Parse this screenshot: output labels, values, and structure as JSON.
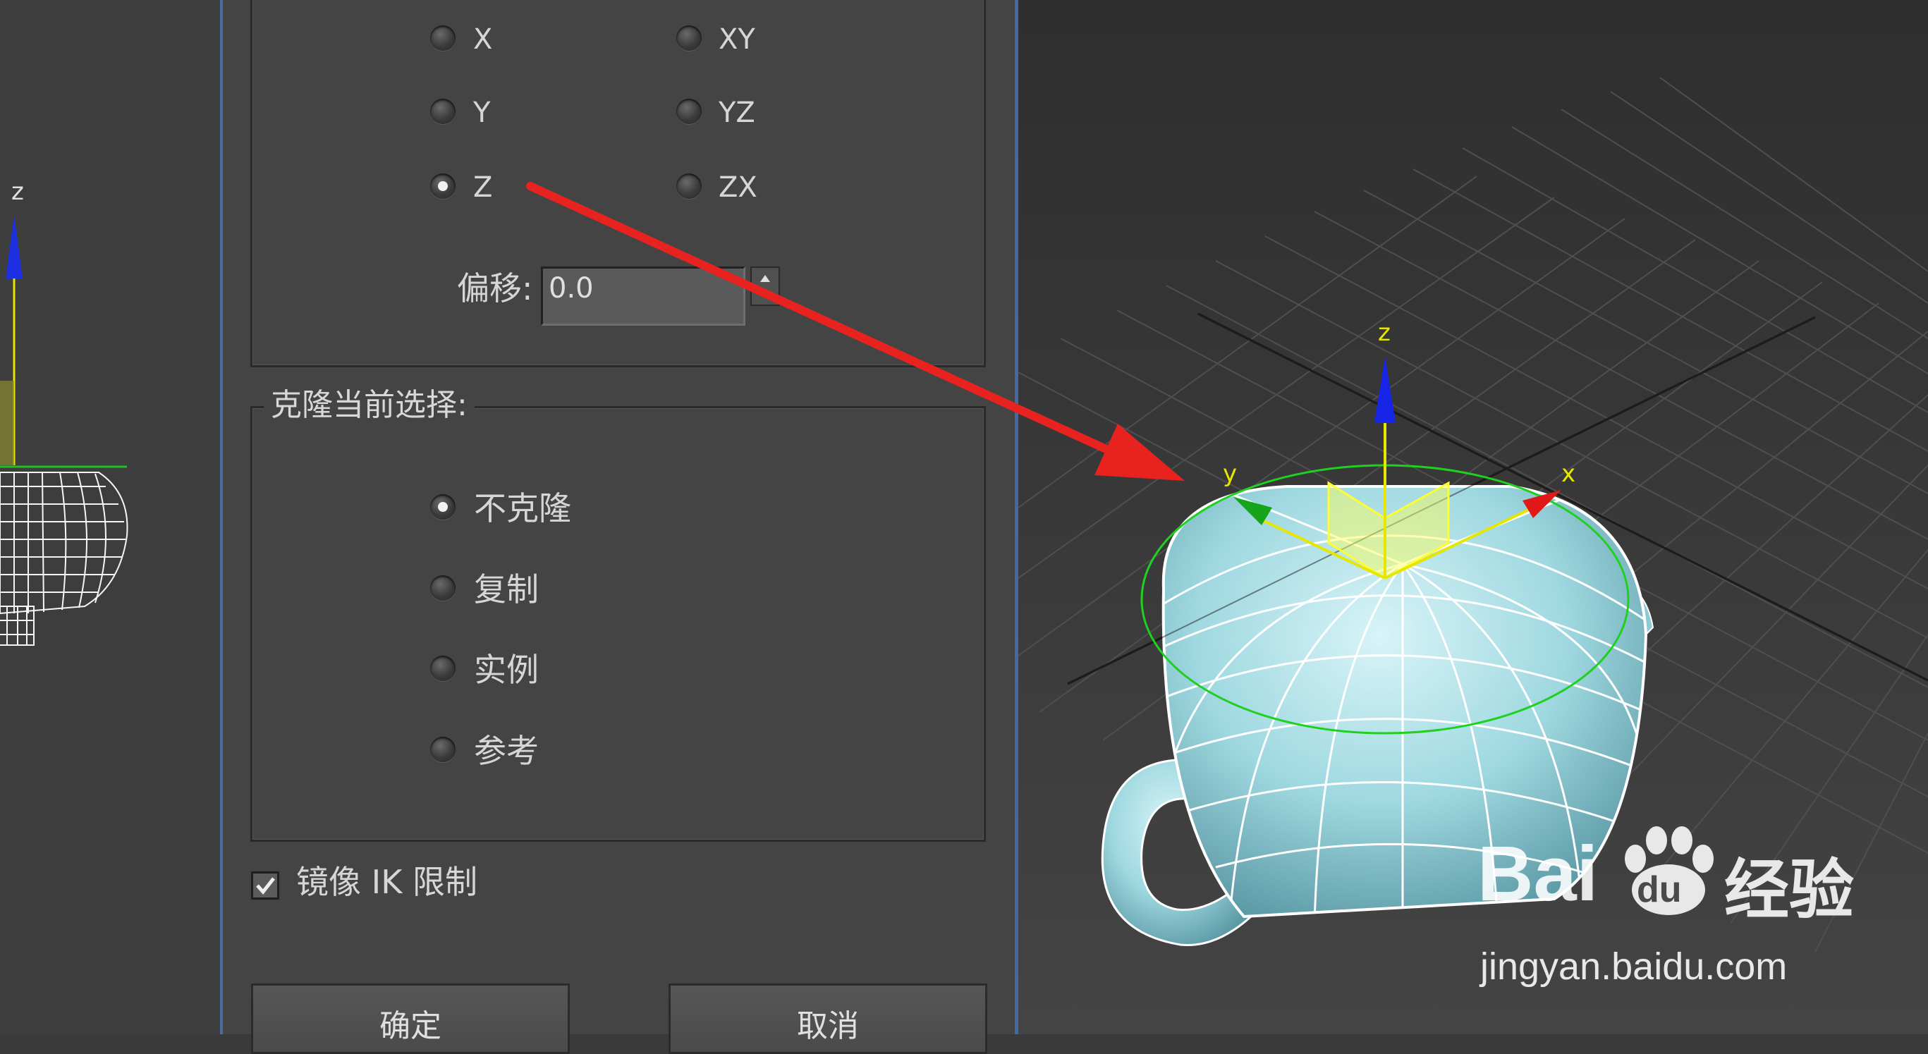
{
  "left_viewport": {
    "axis_z": "z"
  },
  "mirror_axis": {
    "options": [
      {
        "label": "X",
        "selected": false
      },
      {
        "label": "Y",
        "selected": false
      },
      {
        "label": "Z",
        "selected": true
      },
      {
        "label": "XY",
        "selected": false
      },
      {
        "label": "YZ",
        "selected": false
      },
      {
        "label": "ZX",
        "selected": false
      }
    ],
    "offset_label": "偏移:",
    "offset_value": "0.0"
  },
  "clone": {
    "title": "克隆当前选择:",
    "options": [
      {
        "label": "不克隆",
        "selected": true
      },
      {
        "label": "复制",
        "selected": false
      },
      {
        "label": "实例",
        "selected": false
      },
      {
        "label": "参考",
        "selected": false
      }
    ]
  },
  "mirror_ik": {
    "label": "镜像 IK 限制",
    "checked": true
  },
  "buttons": {
    "ok": "确定",
    "cancel": "取消"
  },
  "perspective": {
    "gizmo": {
      "z": "z",
      "y": "y",
      "x": "x"
    },
    "colors": {
      "x_axis": "#e01010",
      "y_axis": "#10a010",
      "z_axis": "#1020e0",
      "plane": "#ffff40",
      "ring": "#20d020",
      "teapot": "#9fd8e0",
      "annotation_arrow": "#e8231f"
    }
  },
  "watermark": {
    "brand_left": "Bai",
    "brand_right": "经验",
    "paw_text": "du",
    "url": "jingyan.baidu.com"
  }
}
